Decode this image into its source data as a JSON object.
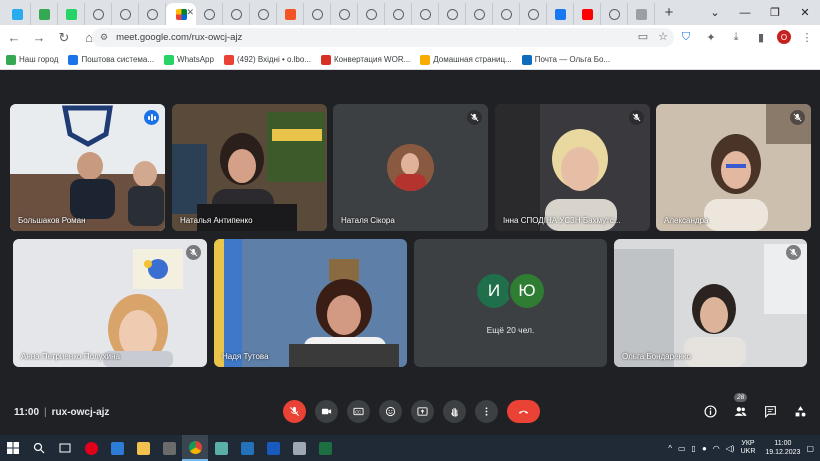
{
  "browser": {
    "url": "meet.google.com/rux-owcj-ajz",
    "profile_initial": "O",
    "tabs": [
      {
        "icon": "telegram-icon",
        "color": "#2aabee"
      },
      {
        "icon": "chart-icon",
        "color": "#34a853"
      },
      {
        "icon": "whatsapp-icon",
        "color": "#25d366"
      },
      {
        "icon": "globe-icon",
        "color": "#5f6368"
      },
      {
        "icon": "globe-icon",
        "color": "#5f6368"
      },
      {
        "icon": "globe-icon",
        "color": "#5f6368"
      },
      {
        "icon": "meet-icon",
        "color": "#ffffff",
        "active": true
      },
      {
        "icon": "globe-icon",
        "color": "#5f6368"
      },
      {
        "icon": "globe-icon",
        "color": "#5f6368"
      },
      {
        "icon": "globe-icon",
        "color": "#5f6368"
      },
      {
        "icon": "microsoft-icon",
        "color": "#f35325"
      },
      {
        "icon": "globe-icon",
        "color": "#5f6368"
      },
      {
        "icon": "globe-icon",
        "color": "#5f6368"
      },
      {
        "icon": "globe-icon",
        "color": "#5f6368"
      },
      {
        "icon": "globe-icon",
        "color": "#5f6368"
      },
      {
        "icon": "globe-icon",
        "color": "#5f6368"
      },
      {
        "icon": "globe-icon",
        "color": "#5f6368"
      },
      {
        "icon": "globe-icon",
        "color": "#5f6368"
      },
      {
        "icon": "globe-icon",
        "color": "#5f6368"
      },
      {
        "icon": "globe-icon",
        "color": "#5f6368"
      },
      {
        "icon": "facebook-icon",
        "color": "#1877f2"
      },
      {
        "icon": "youtube-icon",
        "color": "#ff0000"
      },
      {
        "icon": "globe-icon",
        "color": "#5f6368"
      },
      {
        "icon": "image-icon",
        "color": "#9aa0a6"
      }
    ]
  },
  "bookmarks": [
    {
      "label": "Наш город",
      "color": "#34a853"
    },
    {
      "label": "Поштова система...",
      "color": "#1a73e8"
    },
    {
      "label": "WhatsApp",
      "color": "#25d366"
    },
    {
      "label": "(492) Вхідні • o.lbo...",
      "color": "#ea4335"
    },
    {
      "label": "Конвертация WOR...",
      "color": "#d93025"
    },
    {
      "label": "Домашная страниц...",
      "color": "#f9ab00"
    },
    {
      "label": "Почта — Ольга Бо...",
      "color": "#0f6cbd"
    }
  ],
  "participants": [
    {
      "name": "Большаков Роман",
      "speaking": true
    },
    {
      "name": "Наталья Антипенко"
    },
    {
      "name": "Наталя Сікора",
      "muted": true
    },
    {
      "name": "Інна СПОДІНА УСЗН Бахмутс...",
      "muted": true
    },
    {
      "name": "Александра",
      "muted": true
    },
    {
      "name": "Анна Петриенко-Полухина",
      "muted": true
    },
    {
      "name": "Надя Тутова"
    },
    {
      "name": "Ольга Бондаренко",
      "muted": true
    }
  ],
  "others": {
    "label": "Ещё 20 чел.",
    "initials": [
      "И",
      "Ю"
    ],
    "colors": [
      "#1e6f4a",
      "#2e7d32"
    ]
  },
  "meeting": {
    "time": "11:00",
    "code": "rux-owcj-ajz",
    "people_count": "28"
  },
  "taskbar": {
    "lang_top": "УКР",
    "lang_bottom": "UKR",
    "time": "11:00",
    "date": "19.12.2023"
  }
}
